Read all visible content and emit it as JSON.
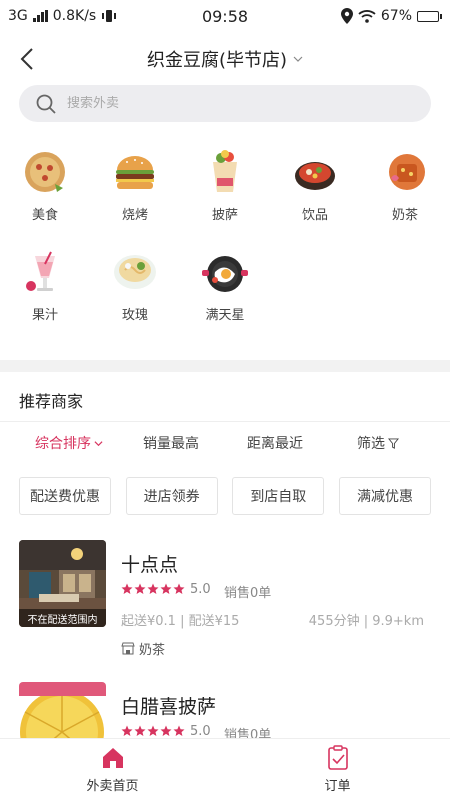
{
  "status_bar": {
    "network": "3G",
    "speed": "0.8K/s",
    "time": "09:58",
    "battery": "67%",
    "battery_level": 0.67
  },
  "header": {
    "title": "织金豆腐(毕节店)"
  },
  "search": {
    "placeholder": "搜索外卖"
  },
  "categories": [
    {
      "label": "美食",
      "icon": "pizza-icon"
    },
    {
      "label": "烧烤",
      "icon": "burger-icon"
    },
    {
      "label": "披萨",
      "icon": "drink-cup-icon"
    },
    {
      "label": "饮品",
      "icon": "hotpot-icon"
    },
    {
      "label": "奶茶",
      "icon": "cake-icon"
    },
    {
      "label": "果汁",
      "icon": "juice-icon"
    },
    {
      "label": "玫瑰",
      "icon": "noodle-bowl-icon"
    },
    {
      "label": "满天星",
      "icon": "frying-pan-icon"
    }
  ],
  "section": {
    "title": "推荐商家"
  },
  "sorts": [
    {
      "label": "综合排序",
      "active": true
    },
    {
      "label": "销量最高"
    },
    {
      "label": "距离最近"
    },
    {
      "label": "筛选"
    }
  ],
  "filters": [
    {
      "label": "配送费优惠"
    },
    {
      "label": "进店领券"
    },
    {
      "label": "到店自取"
    },
    {
      "label": "满减优惠"
    }
  ],
  "shops": [
    {
      "name": "十点点",
      "rating": "5.0",
      "sales": "销售0单",
      "delivery": "起送¥0.1 | 配送¥15",
      "distance": "455分钟 | 9.9+km",
      "tag": "奶茶",
      "badge": "不在配送范围内",
      "stars": 5
    },
    {
      "name": "白腊喜披萨",
      "rating": "5.0",
      "sales": "销售0单",
      "stars": 5
    }
  ],
  "tabbar": {
    "home": "外卖首页",
    "orders": "订单",
    "accent": "#d7345f"
  }
}
